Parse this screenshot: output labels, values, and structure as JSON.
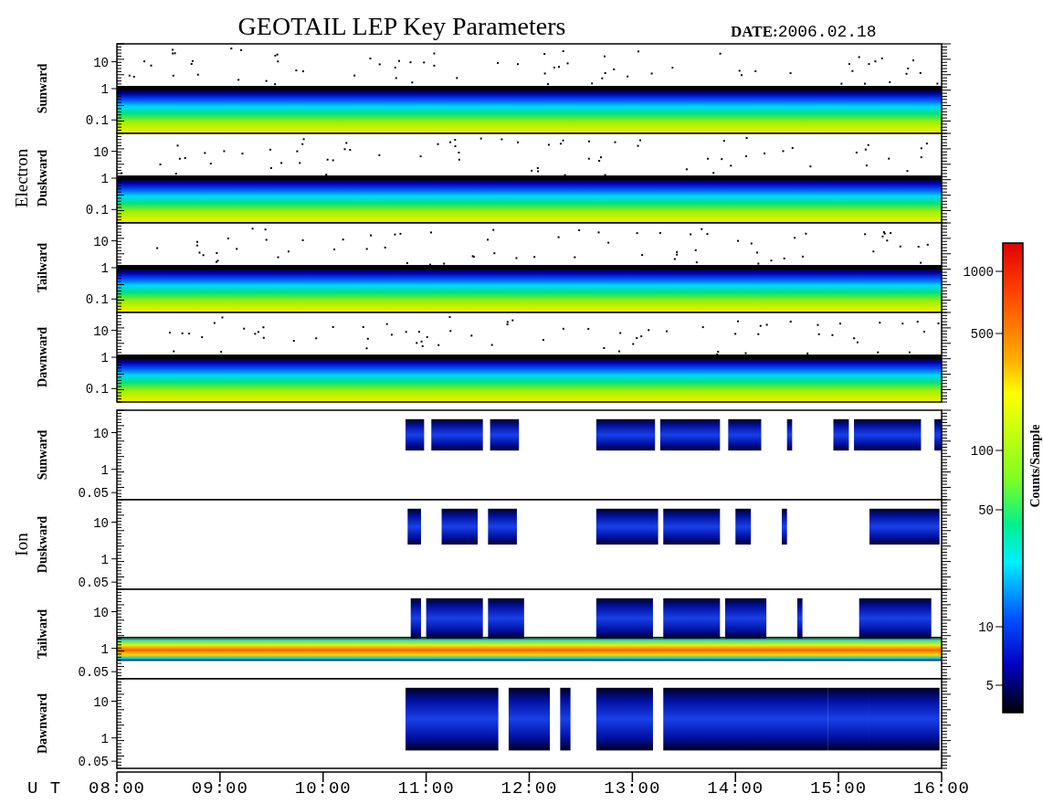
{
  "title": "GEOTAIL LEP Key Parameters",
  "date_label": "DATE:",
  "date": "2006.02.18",
  "groups": [
    {
      "name": "Electron",
      "kind": "electron",
      "panels": [
        {
          "label": "Sunward",
          "yticks": [
            "10",
            "1",
            "0.1"
          ]
        },
        {
          "label": "Duskward",
          "yticks": [
            "10",
            "1",
            "0.1"
          ]
        },
        {
          "label": "Tailward",
          "yticks": [
            "10",
            "1",
            "0.1"
          ]
        },
        {
          "label": "Dawnward",
          "yticks": [
            "10",
            "1",
            "0.1"
          ]
        }
      ]
    },
    {
      "name": "Ion",
      "kind": "ion",
      "panels": [
        {
          "label": "Sunward",
          "yticks": [
            "10",
            "1",
            "0.05"
          ]
        },
        {
          "label": "Duskward",
          "yticks": [
            "10",
            "1",
            "0.05"
          ]
        },
        {
          "label": "Tailward",
          "yticks": [
            "10",
            "1",
            "0.05"
          ]
        },
        {
          "label": "Dawnward",
          "yticks": [
            "10",
            "1",
            "0.05"
          ]
        }
      ]
    }
  ],
  "x_axis": {
    "label": "U T",
    "ticks": [
      "08:00",
      "09:00",
      "10:00",
      "11:00",
      "12:00",
      "13:00",
      "14:00",
      "15:00",
      "16:00"
    ]
  },
  "colorbar": {
    "label": "Counts/Sample",
    "ticks": [
      "1000",
      "500",
      "100",
      "50",
      "10",
      "5"
    ]
  }
}
